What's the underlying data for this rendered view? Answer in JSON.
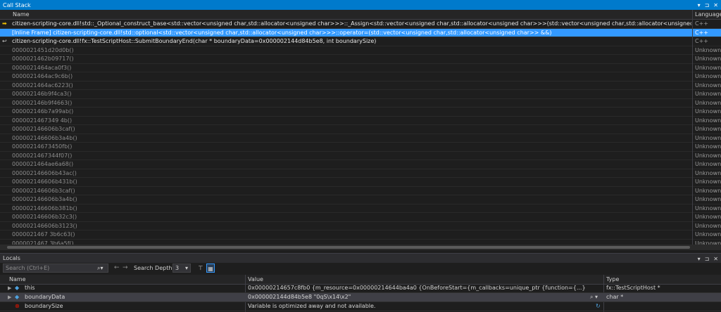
{
  "callstack": {
    "title": "Call Stack",
    "columns": {
      "name": "Name",
      "language": "Language"
    },
    "frames": [
      {
        "name": "citizen-scripting-core.dll!std::_Optional_construct_base<std::vector<unsigned char,std::allocator<unsigned char>>>::_Assign<std::vector<unsigned char,std::allocator<unsigned char>>>(std::vector<unsigned char,std::allocator<unsigned char>> && _Right={...})",
        "lang": "C++",
        "state": "current",
        "marker": "arrow"
      },
      {
        "name": "[Inline Frame] citizen-scripting-core.dll!std::optional<std::vector<unsigned char,std::allocator<unsigned char>>>::operator=(std::vector<unsigned char,std::allocator<unsigned char>> &&)",
        "lang": "C++",
        "state": "selected",
        "marker": ""
      },
      {
        "name": "citizen-scripting-core.dll!fx::TestScriptHost::SubmitBoundaryEnd(char * boundaryData=0x000002144d84b5e8, int boundarySize)",
        "lang": "C++",
        "state": "current",
        "marker": "return"
      },
      {
        "name": "0000021451d20d0b()",
        "lang": "Unknown",
        "state": "unknown"
      },
      {
        "name": "0000021462b09717()",
        "lang": "Unknown",
        "state": "unknown"
      },
      {
        "name": "0000021464aca0f3()",
        "lang": "Unknown",
        "state": "unknown"
      },
      {
        "name": "0000021464ac9c6b()",
        "lang": "Unknown",
        "state": "unknown"
      },
      {
        "name": "0000021464ac6223()",
        "lang": "Unknown",
        "state": "unknown"
      },
      {
        "name": "000002146b9f4ca3()",
        "lang": "Unknown",
        "state": "unknown"
      },
      {
        "name": "000002146b9f4663()",
        "lang": "Unknown",
        "state": "unknown"
      },
      {
        "name": "000002146b7a99ab()",
        "lang": "Unknown",
        "state": "unknown"
      },
      {
        "name": "0000021467349 4b()",
        "lang": "Unknown",
        "state": "unknown"
      },
      {
        "name": "000002146606b3caf()",
        "lang": "Unknown",
        "state": "unknown"
      },
      {
        "name": "000002146606b3a4b()",
        "lang": "Unknown",
        "state": "unknown"
      },
      {
        "name": "00000214673450fb()",
        "lang": "Unknown",
        "state": "unknown"
      },
      {
        "name": "0000021467344f07()",
        "lang": "Unknown",
        "state": "unknown"
      },
      {
        "name": "0000021464ae6a68()",
        "lang": "Unknown",
        "state": "unknown"
      },
      {
        "name": "000002146606b43ac()",
        "lang": "Unknown",
        "state": "unknown"
      },
      {
        "name": "000002146606b431b()",
        "lang": "Unknown",
        "state": "unknown"
      },
      {
        "name": "000002146606b3caf()",
        "lang": "Unknown",
        "state": "unknown"
      },
      {
        "name": "000002146606b3a4b()",
        "lang": "Unknown",
        "state": "unknown"
      },
      {
        "name": "000002146606b381b()",
        "lang": "Unknown",
        "state": "unknown"
      },
      {
        "name": "000002146606b32c3()",
        "lang": "Unknown",
        "state": "unknown"
      },
      {
        "name": "000002146606b3123()",
        "lang": "Unknown",
        "state": "unknown"
      },
      {
        "name": "0000021467 3b6c63()",
        "lang": "Unknown",
        "state": "unknown"
      },
      {
        "name": "0000021467 3b6a5f()",
        "lang": "Unknown",
        "state": "unknown"
      },
      {
        "name": "0000021467 3b674b()",
        "lang": "Unknown",
        "state": "unknown"
      },
      {
        "name": "00000214651 3edfb()",
        "lang": "Unknown",
        "state": "unknown"
      }
    ]
  },
  "locals": {
    "title": "Locals",
    "search_placeholder": "Search (Ctrl+E)",
    "depth_label": "Search Depth:",
    "depth_value": "3",
    "columns": {
      "name": "Name",
      "value": "Value",
      "type": "Type"
    },
    "rows": [
      {
        "name": "this",
        "value": "0x00000214657c8fb0 {m_resource=0x00000214644ba4a0 {OnBeforeStart={m_callbacks=unique_ptr {function={...} next=??? order=??? ...} } ...} ...}",
        "type": "fx::TestScriptHost *",
        "icon": "field",
        "state": "normal"
      },
      {
        "name": "boundaryData",
        "value": "0x000002144d84b5e8 \"0qS\\x14\\x2\"",
        "type": "char *",
        "icon": "field",
        "state": "selected"
      },
      {
        "name": "boundarySize",
        "value": "Variable is optimized away and not available.",
        "type": "",
        "icon": "error",
        "state": "normal"
      }
    ]
  },
  "colors": {
    "accent": "#007acc",
    "selected_row": "#3399ff",
    "frame_arrow": "#f2c200",
    "error": "#e51400"
  }
}
